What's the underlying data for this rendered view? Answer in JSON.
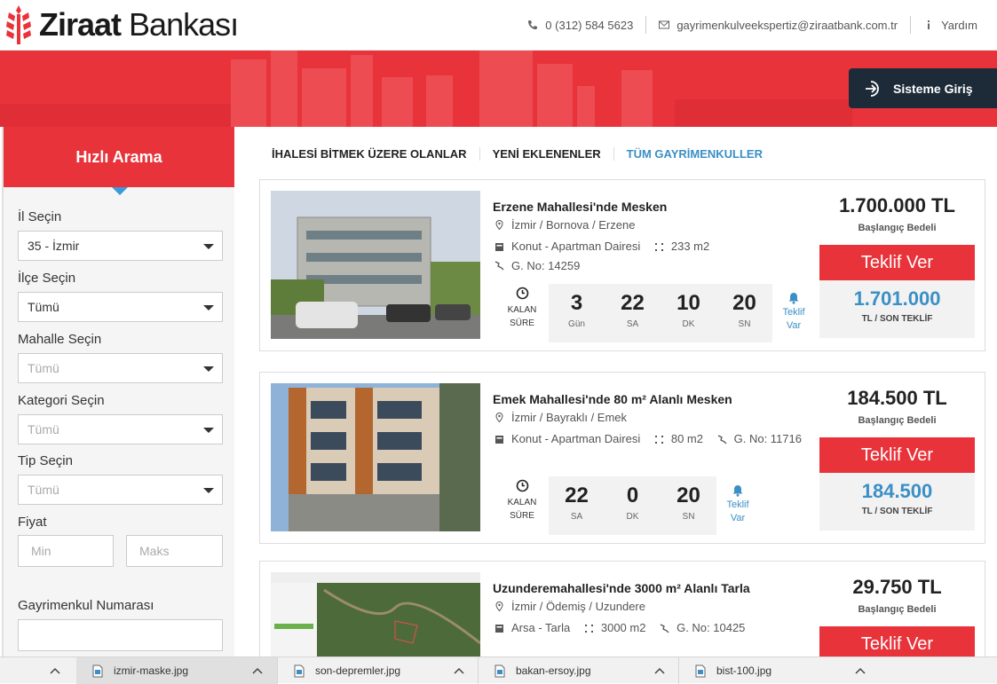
{
  "header": {
    "brand_bold": "Ziraat",
    "brand_rest": " Bankası",
    "phone": "0 (312) 584 5623",
    "email": "gayrimenkulveekspertiz@ziraatbank.com.tr",
    "help": "Yardım"
  },
  "banner": {
    "login_label": "Sisteme Giriş"
  },
  "sidebar": {
    "title": "Hızlı Arama",
    "il_label": "İl Seçin",
    "il_value": "35 - İzmir",
    "ilce_label": "İlçe Seçin",
    "ilce_value": "Tümü",
    "mahalle_label": "Mahalle Seçin",
    "mahalle_value": "Tümü",
    "kategori_label": "Kategori Seçin",
    "kategori_value": "Tümü",
    "tip_label": "Tip Seçin",
    "tip_value": "Tümü",
    "fiyat_label": "Fiyat",
    "min_placeholder": "Min",
    "max_placeholder": "Maks",
    "gno_label": "Gayrimenkul Numarası"
  },
  "tabs": [
    "İHALESİ BİTMEK ÜZERE OLANLAR",
    "YENİ EKLENENLER",
    "TÜM GAYRİMENKULLER"
  ],
  "colors": {
    "brand_red": "#e8333b",
    "navy": "#1d2b39",
    "link_blue": "#3a8fc6"
  },
  "listings": [
    {
      "title": "Erzene Mahallesi'nde Mesken",
      "location": "İzmir / Bornova / Erzene",
      "type": "Konut - Apartman Dairesi",
      "area": "233 m2",
      "gno": "G. No: 14259",
      "kalan": "KALAN",
      "sure": "SÜRE",
      "timer": [
        {
          "num": "3",
          "unit": "Gün"
        },
        {
          "num": "22",
          "unit": "SA"
        },
        {
          "num": "10",
          "unit": "DK"
        },
        {
          "num": "20",
          "unit": "SN"
        }
      ],
      "teklif_var_1": "Teklif",
      "teklif_var_2": "Var",
      "start_price": "1.700.000 TL",
      "start_label": "Başlangıç Bedeli",
      "bid_button": "Teklif Ver",
      "last_bid": "1.701.000",
      "last_label": "TL / SON TEKLİF"
    },
    {
      "title": "Emek Mahallesi'nde 80 m² Alanlı Mesken",
      "location": "İzmir / Bayraklı / Emek",
      "type": "Konut - Apartman Dairesi",
      "area": "80 m2",
      "gno": "G. No: 11716",
      "kalan": "KALAN",
      "sure": "SÜRE",
      "timer": [
        {
          "num": "22",
          "unit": "SA"
        },
        {
          "num": "0",
          "unit": "DK"
        },
        {
          "num": "20",
          "unit": "SN"
        }
      ],
      "teklif_var_1": "Teklif",
      "teklif_var_2": "Var",
      "start_price": "184.500 TL",
      "start_label": "Başlangıç Bedeli",
      "bid_button": "Teklif Ver",
      "last_bid": "184.500",
      "last_label": "TL / SON TEKLİF"
    },
    {
      "title": "Uzunderemahallesi'nde 3000 m² Alanlı Tarla",
      "location": "İzmir / Ödemiş / Uzundere",
      "type": "Arsa - Tarla",
      "area": "3000 m2",
      "gno": "G. No: 10425",
      "start_price": "29.750 TL",
      "start_label": "Başlangıç Bedeli",
      "bid_button": "Teklif Ver"
    }
  ],
  "downloads": [
    "izmir-maske.jpg",
    "son-depremler.jpg",
    "bakan-ersoy.jpg",
    "bist-100.jpg"
  ]
}
